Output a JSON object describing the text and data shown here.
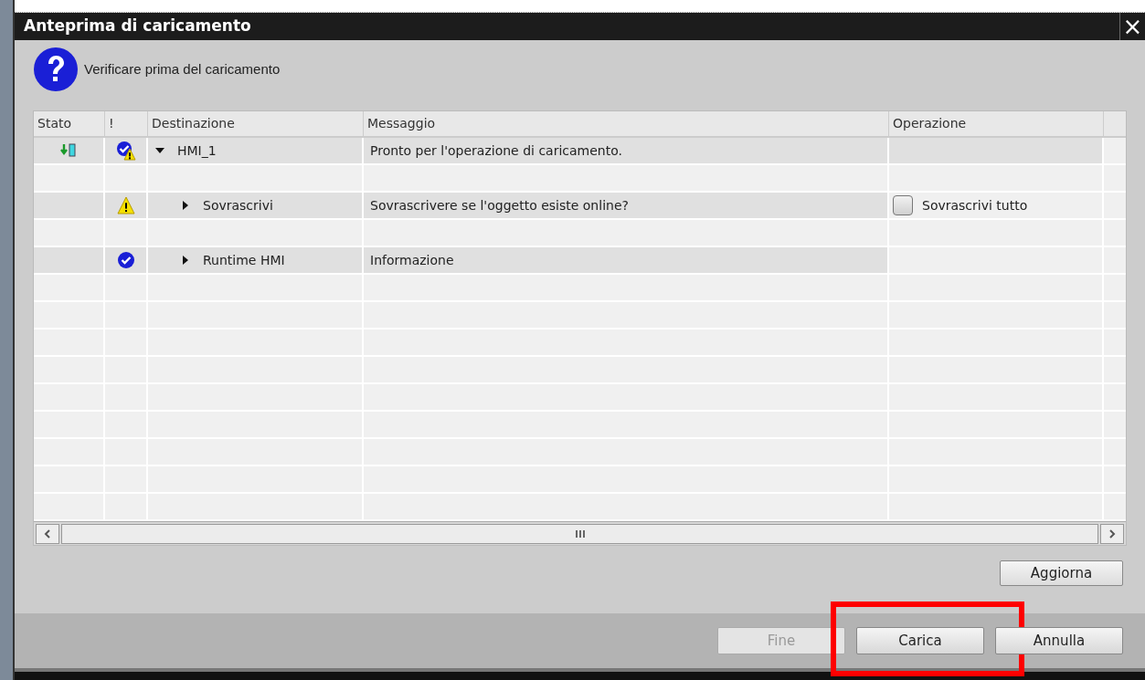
{
  "window": {
    "title": "Anteprima di caricamento",
    "close": "×"
  },
  "prompt": {
    "text": "Verificare prima del caricamento"
  },
  "table": {
    "columns": [
      "Stato",
      "!",
      "Destinazione",
      "Messaggio",
      "Operazione"
    ],
    "rows": [
      {
        "stato": {
          "kind": "download"
        },
        "alert": {
          "kind": "check-warning"
        },
        "target": "HMI_1",
        "message": "Pronto per l'operazione di caricamento.",
        "expanded": true,
        "children": [
          {
            "alert": {
              "kind": "warning"
            },
            "target": "Sovrascrivi",
            "message": "Sovrascrivere se l'oggetto esiste online?",
            "expanded": false,
            "action": {
              "label": "Sovrascrivi tutto",
              "checked": false
            }
          },
          {
            "alert": {
              "kind": "check"
            },
            "target": "Runtime HMI",
            "message": "Informazione",
            "expanded": false
          }
        ]
      }
    ]
  },
  "refresh_button": "Aggiorna",
  "buttons": [
    {
      "label": "Fine",
      "disabled": true,
      "highlighted": false
    },
    {
      "label": "Carica",
      "disabled": false,
      "highlighted": true
    },
    {
      "label": "Annulla",
      "disabled": false,
      "highlighted": false
    }
  ]
}
